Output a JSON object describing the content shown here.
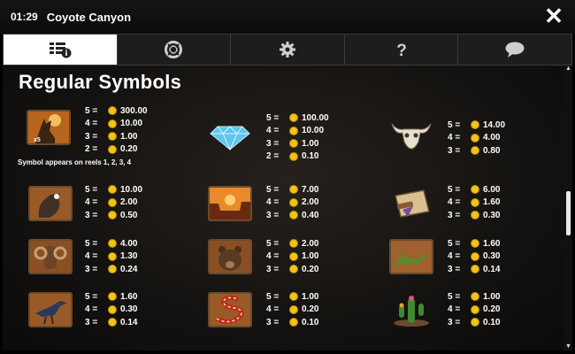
{
  "titlebar": {
    "time": "01:29",
    "game": "Coyote Canyon"
  },
  "tabs": [
    {
      "icon": "paytable-info-icon"
    },
    {
      "icon": "lifebuoy-icon"
    },
    {
      "icon": "gear-icon"
    },
    {
      "icon": "question-icon"
    },
    {
      "icon": "chat-bubble-icon"
    }
  ],
  "heading": "Regular Symbols",
  "note": "Symbol appears on reels 1, 2, 3, 4",
  "symbols": [
    {
      "name": "coyote",
      "badge": "x5",
      "pays": [
        {
          "c": "5 =",
          "v": "300.00"
        },
        {
          "c": "4 =",
          "v": "10.00"
        },
        {
          "c": "3 =",
          "v": "1.00"
        },
        {
          "c": "2 =",
          "v": "0.20"
        }
      ]
    },
    {
      "name": "diamond",
      "pays": [
        {
          "c": "5 =",
          "v": "100.00"
        },
        {
          "c": "4 =",
          "v": "10.00"
        },
        {
          "c": "3 =",
          "v": "1.00"
        },
        {
          "c": "2 =",
          "v": "0.10"
        }
      ]
    },
    {
      "name": "bull-skull",
      "pays": [
        {
          "c": "5 =",
          "v": "14.00"
        },
        {
          "c": "4 =",
          "v": "4.00"
        },
        {
          "c": "3 =",
          "v": "0.80"
        }
      ]
    },
    {
      "name": "eagle",
      "pays": [
        {
          "c": "5 =",
          "v": "10.00"
        },
        {
          "c": "4 =",
          "v": "2.00"
        },
        {
          "c": "3 =",
          "v": "0.50"
        }
      ]
    },
    {
      "name": "canyon",
      "pays": [
        {
          "c": "5 =",
          "v": "7.00"
        },
        {
          "c": "4 =",
          "v": "2.00"
        },
        {
          "c": "3 =",
          "v": "0.40"
        }
      ]
    },
    {
      "name": "map-scroll",
      "pays": [
        {
          "c": "5 =",
          "v": "6.00"
        },
        {
          "c": "4 =",
          "v": "1.60"
        },
        {
          "c": "3 =",
          "v": "0.30"
        }
      ]
    },
    {
      "name": "ram",
      "pays": [
        {
          "c": "5 =",
          "v": "4.00"
        },
        {
          "c": "4 =",
          "v": "1.30"
        },
        {
          "c": "3 =",
          "v": "0.24"
        }
      ]
    },
    {
      "name": "bear",
      "pays": [
        {
          "c": "5 =",
          "v": "2.00"
        },
        {
          "c": "4 =",
          "v": "1.00"
        },
        {
          "c": "3 =",
          "v": "0.20"
        }
      ]
    },
    {
      "name": "lizard",
      "pays": [
        {
          "c": "5 =",
          "v": "1.60"
        },
        {
          "c": "4 =",
          "v": "0.30"
        },
        {
          "c": "3 =",
          "v": "0.14"
        }
      ]
    },
    {
      "name": "roadrunner",
      "pays": [
        {
          "c": "5 =",
          "v": "1.60"
        },
        {
          "c": "4 =",
          "v": "0.30"
        },
        {
          "c": "3 =",
          "v": "0.14"
        }
      ]
    },
    {
      "name": "snake",
      "pays": [
        {
          "c": "5 =",
          "v": "1.00"
        },
        {
          "c": "4 =",
          "v": "0.20"
        },
        {
          "c": "3 =",
          "v": "0.10"
        }
      ]
    },
    {
      "name": "cactus",
      "pays": [
        {
          "c": "5 =",
          "v": "1.00"
        },
        {
          "c": "4 =",
          "v": "0.20"
        },
        {
          "c": "3 =",
          "v": "0.10"
        }
      ]
    }
  ],
  "colors": {
    "coin": "#f2c417",
    "active_tab": "#ffffff",
    "frame": "#6a4a2c"
  }
}
